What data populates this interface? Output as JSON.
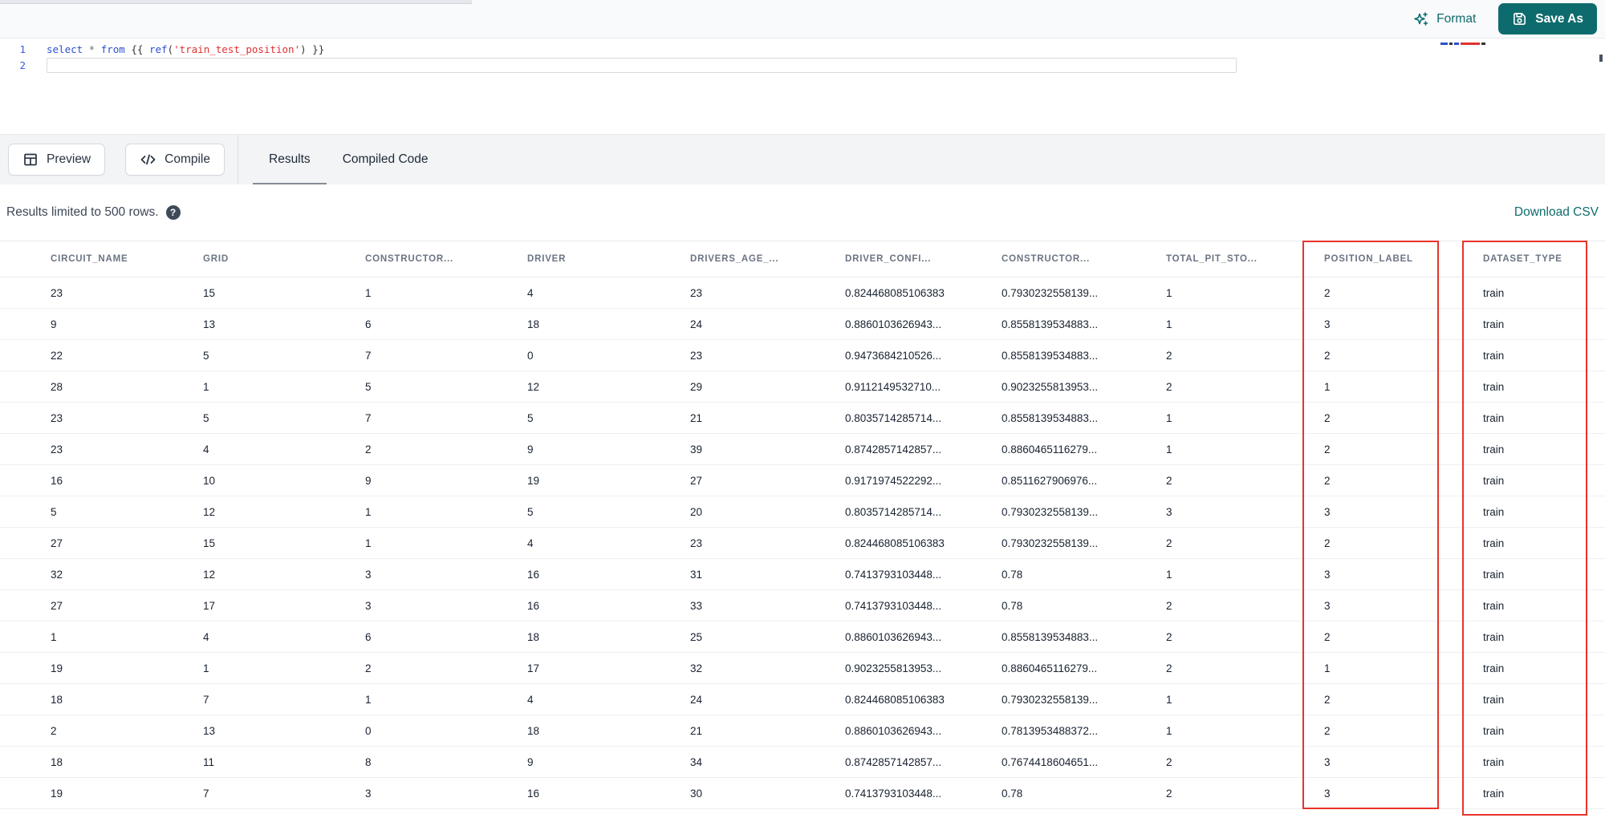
{
  "colors": {
    "accent_teal": "#0e6b6d",
    "highlight_red": "#e8332a",
    "keyword_blue": "#2b4fd1",
    "string_red": "#e03131"
  },
  "top_bar": {
    "format_label": "Format",
    "save_as_label": "Save As"
  },
  "editor": {
    "lines": [
      {
        "number": "1",
        "tokens": [
          {
            "t": "kw",
            "v": "select"
          },
          {
            "t": "op",
            "v": " * "
          },
          {
            "t": "kw",
            "v": "from"
          },
          {
            "t": "pn",
            "v": " {{ "
          },
          {
            "t": "fn",
            "v": "ref"
          },
          {
            "t": "pn",
            "v": "("
          },
          {
            "t": "str",
            "v": "'train_test_position'"
          },
          {
            "t": "pn",
            "v": ")"
          },
          {
            "t": "pn",
            "v": " }}"
          }
        ]
      },
      {
        "number": "2",
        "tokens": []
      }
    ],
    "minimap": [
      {
        "c": "#2b4fd1",
        "w": 9
      },
      {
        "c": "#37352f",
        "w": 4
      },
      {
        "c": "#2b4fd1",
        "w": 6
      },
      {
        "c": "#e03131",
        "w": 24
      },
      {
        "c": "#37352f",
        "w": 5
      }
    ]
  },
  "toolbar": {
    "preview_label": "Preview",
    "compile_label": "Compile",
    "tabs": [
      {
        "label": "Results",
        "active": true
      },
      {
        "label": "Compiled Code",
        "active": false
      }
    ]
  },
  "results_bar": {
    "limit_text": "Results limited to 500 rows.",
    "help_glyph": "?",
    "download_label": "Download CSV"
  },
  "table": {
    "columns": [
      "CIRCUIT_NAME",
      "GRID",
      "CONSTRUCTOR...",
      "DRIVER",
      "DRIVERS_AGE_...",
      "DRIVER_CONFI...",
      "CONSTRUCTOR...",
      "TOTAL_PIT_STO...",
      "POSITION_LABEL",
      "DATASET_TYPE"
    ],
    "highlighted_columns": [
      "POSITION_LABEL",
      "DATASET_TYPE"
    ],
    "rows": [
      [
        "23",
        "15",
        "1",
        "4",
        "23",
        "0.824468085106383",
        "0.7930232558139...",
        "1",
        "2",
        "train"
      ],
      [
        "9",
        "13",
        "6",
        "18",
        "24",
        "0.8860103626943...",
        "0.8558139534883...",
        "1",
        "3",
        "train"
      ],
      [
        "22",
        "5",
        "7",
        "0",
        "23",
        "0.9473684210526...",
        "0.8558139534883...",
        "2",
        "2",
        "train"
      ],
      [
        "28",
        "1",
        "5",
        "12",
        "29",
        "0.9112149532710...",
        "0.9023255813953...",
        "2",
        "1",
        "train"
      ],
      [
        "23",
        "5",
        "7",
        "5",
        "21",
        "0.8035714285714...",
        "0.8558139534883...",
        "1",
        "2",
        "train"
      ],
      [
        "23",
        "4",
        "2",
        "9",
        "39",
        "0.8742857142857...",
        "0.8860465116279...",
        "1",
        "2",
        "train"
      ],
      [
        "16",
        "10",
        "9",
        "19",
        "27",
        "0.9171974522292...",
        "0.8511627906976...",
        "2",
        "2",
        "train"
      ],
      [
        "5",
        "12",
        "1",
        "5",
        "20",
        "0.8035714285714...",
        "0.7930232558139...",
        "3",
        "3",
        "train"
      ],
      [
        "27",
        "15",
        "1",
        "4",
        "23",
        "0.824468085106383",
        "0.7930232558139...",
        "2",
        "2",
        "train"
      ],
      [
        "32",
        "12",
        "3",
        "16",
        "31",
        "0.7413793103448...",
        "0.78",
        "1",
        "3",
        "train"
      ],
      [
        "27",
        "17",
        "3",
        "16",
        "33",
        "0.7413793103448...",
        "0.78",
        "2",
        "3",
        "train"
      ],
      [
        "1",
        "4",
        "6",
        "18",
        "25",
        "0.8860103626943...",
        "0.8558139534883...",
        "2",
        "2",
        "train"
      ],
      [
        "19",
        "1",
        "2",
        "17",
        "32",
        "0.9023255813953...",
        "0.8860465116279...",
        "2",
        "1",
        "train"
      ],
      [
        "18",
        "7",
        "1",
        "4",
        "24",
        "0.824468085106383",
        "0.7930232558139...",
        "1",
        "2",
        "train"
      ],
      [
        "2",
        "13",
        "0",
        "18",
        "21",
        "0.8860103626943...",
        "0.7813953488372...",
        "1",
        "2",
        "train"
      ],
      [
        "18",
        "11",
        "8",
        "9",
        "34",
        "0.8742857142857...",
        "0.7674418604651...",
        "2",
        "3",
        "train"
      ],
      [
        "19",
        "7",
        "3",
        "16",
        "30",
        "0.7413793103448...",
        "0.78",
        "2",
        "3",
        "train"
      ]
    ]
  }
}
